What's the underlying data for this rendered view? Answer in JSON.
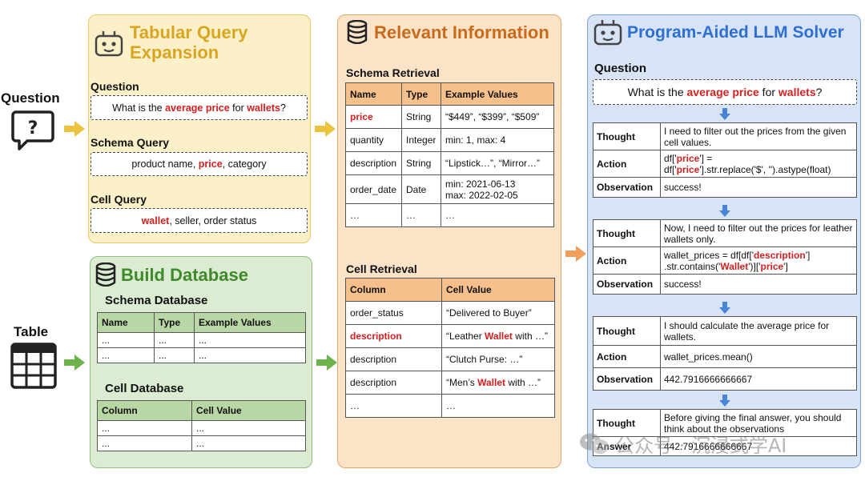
{
  "left": {
    "question_label": "Question",
    "table_label": "Table"
  },
  "expansion": {
    "title_line1": "Tabular Query",
    "title_line2": "Expansion",
    "question_label": "Question",
    "question_pre": "What is the ",
    "question_hl1": "average price",
    "question_mid": " for ",
    "question_hl2": "wallets",
    "question_post": "?",
    "schema_query_label": "Schema Query",
    "schema_pre": "product name, ",
    "schema_hl": "price",
    "schema_post": ", category",
    "cell_query_label": "Cell Query",
    "cell_hl": "wallet",
    "cell_post": ", seller, order status"
  },
  "build": {
    "title": "Build Database",
    "schema_db_label": "Schema Database",
    "schema_headers": [
      "Name",
      "Type",
      "Example Values"
    ],
    "schema_rows": [
      [
        "...",
        "...",
        "..."
      ],
      [
        "...",
        "...",
        "..."
      ]
    ],
    "cell_db_label": "Cell Database",
    "cell_headers": [
      "Column",
      "Cell Value"
    ],
    "cell_rows": [
      [
        "...",
        "..."
      ],
      [
        "...",
        "..."
      ]
    ]
  },
  "relevant": {
    "title": "Relevant Information",
    "schema_retrieval_label": "Schema Retrieval",
    "schema_headers": [
      "Name",
      "Type",
      "Example Values"
    ],
    "schema_rows": [
      {
        "name": "price",
        "type": "String",
        "values": "“$449”, “$399”, “$509”",
        "hl": true
      },
      {
        "name": "quantity",
        "type": "Integer",
        "values": "min: 1, max: 4"
      },
      {
        "name": "description",
        "type": "String",
        "values": "“Lipstick…”, “Mirror…”"
      },
      {
        "name": "order_date",
        "type": "Date",
        "values1": "min: 2021-06-13",
        "values2": "max: 2022-02-05"
      },
      {
        "name": "…",
        "type": "…",
        "values": "…"
      }
    ],
    "cell_retrieval_label": "Cell Retrieval",
    "cell_headers": [
      "Column",
      "Cell Value"
    ],
    "cell_rows": [
      {
        "col": "order_status",
        "pre": "“Delivered to Buyer”"
      },
      {
        "col": "description",
        "pre": "“Leather ",
        "hl": "Wallet",
        "post": " with …”",
        "red_col": true
      },
      {
        "col": "description",
        "pre": "“Clutch Purse: …”"
      },
      {
        "col": "description",
        "pre": "“Men’s ",
        "hl": "Wallet",
        "post": " with …”"
      },
      {
        "col": "…",
        "pre": "…"
      }
    ]
  },
  "solver": {
    "title": "Program-Aided LLM Solver",
    "question_label": "Question",
    "question_pre": "What is the ",
    "question_hl1": "average price",
    "question_mid": " for ",
    "question_hl2": "wallets",
    "question_post": "?",
    "labels": {
      "thought": "Thought",
      "action": "Action",
      "observation": "Observation",
      "answer": "Answer"
    },
    "step1": {
      "thought": "I need to filter out the prices from the given cell values.",
      "action_a": "df['",
      "action_b": "price",
      "action_c": "'] =",
      "action_d": "df['",
      "action_e": "price",
      "action_f": "'].str.replace('$', '').astype(float)",
      "observation": "success!"
    },
    "step2": {
      "thought": "Now, I need to filter out the prices for leather wallets only.",
      "action_a": "wallet_prices = df[df['",
      "action_b": "description",
      "action_c": "']",
      "action_d": ".str.contains('",
      "action_e": "Wallet",
      "action_f": "')]['",
      "action_g": "price",
      "action_h": "']",
      "observation": "success!"
    },
    "step3": {
      "thought": "I should calculate the average price for wallets.",
      "action": "wallet_prices.mean()",
      "observation": "442.7916666666667"
    },
    "step4": {
      "thought": "Before giving the final answer, you should think about the observations",
      "answer": "442.7916666666667"
    }
  },
  "watermark": "公众号 · 沉浸式学AI",
  "colors": {
    "red": "#d42020",
    "yellow_title": "#d9a520",
    "green_title": "#3f8a2a",
    "orange_title": "#c96a1a",
    "blue_title": "#2f6fd0",
    "arrow_blue": "#4a84d6"
  }
}
